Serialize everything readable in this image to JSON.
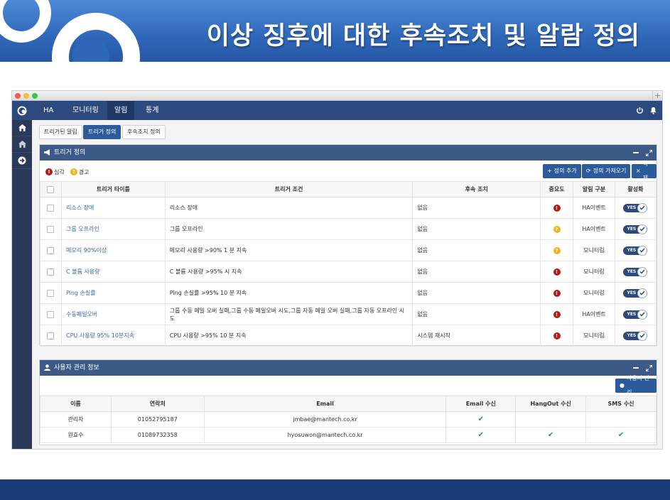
{
  "slide": {
    "title": "이상 징후에 대한 후속조치 및 알람 정의"
  },
  "window": {
    "new_tab_label": "+"
  },
  "nav": {
    "items": [
      "HA",
      "모니터링",
      "알림",
      "통계"
    ],
    "active": "알림"
  },
  "subtabs": [
    "트리거된 알림",
    "트리거 정의",
    "후속조치 정의"
  ],
  "trigger_panel": {
    "title": "트리거 정의",
    "legend": {
      "critical": "심각",
      "warning": "경고"
    },
    "buttons": {
      "add": "정의 추가",
      "import": "정의 가져오기",
      "delete": "삭제"
    },
    "columns": [
      "트리거 타이틀",
      "트리거 조건",
      "후속 조치",
      "중요도",
      "알림 구분",
      "활성화"
    ],
    "toggle_label": "YES",
    "rows": [
      {
        "title": "리소스 장애",
        "condition": "리소스 장애",
        "action": "없음",
        "severity": "critical",
        "type": "HA이벤트"
      },
      {
        "title": "그룹 오프라인",
        "condition": "그룹 오프라인",
        "action": "없음",
        "severity": "warning",
        "type": "HA이벤트"
      },
      {
        "title": "메모리 90%이상",
        "condition": "메모리 사용량 >90% 1 분 지속",
        "action": "없음",
        "severity": "warning",
        "type": "모니터링"
      },
      {
        "title": "C 볼륨 사용량",
        "condition": "C 볼륨 사용량 >95% 시 지속",
        "action": "없음",
        "severity": "critical",
        "type": "모니터링"
      },
      {
        "title": "Ping 손실률",
        "condition": "Ping 손실률 >95% 10 분 지속",
        "action": "없음",
        "severity": "critical",
        "type": "모니터링"
      },
      {
        "title": "수동페일오버",
        "condition": "그룹 수동 페일 오버 실패,그룹 수동 페일오버 시도,그룹 자동 페일 오버 실패,그룹 자동 오프라인 시도",
        "action": "없음",
        "severity": "critical",
        "type": "HA이벤트"
      },
      {
        "title": "CPU 사용량 95% 10분지속",
        "condition": "CPU 사용량 >95% 10 분 지속",
        "action": "시스템 재시작",
        "severity": "critical",
        "type": "모니터링"
      }
    ]
  },
  "user_panel": {
    "title": "사용자 관리 정보",
    "button": "사용자 관리",
    "columns": [
      "이름",
      "연락처",
      "Email",
      "Email 수신",
      "HangOut 수신",
      "SMS 수신"
    ],
    "rows": [
      {
        "name": "관리자",
        "phone": "01052795187",
        "email": "jmbae@mantech.co.kr",
        "email_rx": true,
        "hangout_rx": false,
        "sms_rx": false
      },
      {
        "name": "원효수",
        "phone": "01089732358",
        "email": "hyosuwon@mantech.co.kr",
        "email_rx": true,
        "hangout_rx": true,
        "sms_rx": true
      }
    ]
  },
  "colors": {
    "navbar": "#2c4a7d",
    "sidebar": "#2b3a58",
    "panel_header": "#3d5a86",
    "primary_button": "#2c5a9a",
    "critical": "#b01c1c",
    "warning": "#f0b41c",
    "check": "#2ca02c"
  }
}
